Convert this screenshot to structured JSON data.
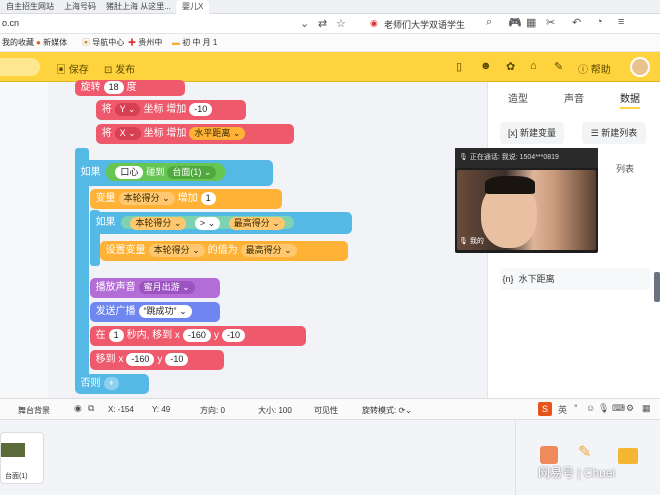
{
  "browser": {
    "tabs": [
      "自主招生网站",
      "上海号码",
      "猪肚上海 从这里...",
      "婴儿X"
    ],
    "address_partial": "o.cn",
    "search_text": "老师们大学双语学生",
    "bookmarks": [
      "我的收藏",
      "新媒体",
      "导航中心",
      "贵州中",
      "初 中 月 1"
    ]
  },
  "editor": {
    "save_label": "保存",
    "publish_label": "发布",
    "tutorial_label": "帮助"
  },
  "right_panel": {
    "tabs": [
      "造型",
      "声音",
      "数据"
    ],
    "new_variable": "新建变量",
    "new_list": "新建列表",
    "list_label": "列表",
    "variable_item": "水下距离",
    "variable_item_icon": "{n}"
  },
  "video_call": {
    "caption": "正在通话: 我说: 1504***0819",
    "mic_label": "我的"
  },
  "blocks": {
    "b1": {
      "prefix": "旋转",
      "value": "18",
      "suffix": "度"
    },
    "b2": {
      "prefix": "将",
      "dd": "Y",
      "mid": "坐标 增加",
      "value": "-10"
    },
    "b3": {
      "prefix": "将",
      "dd": "X",
      "mid": "坐标 增加",
      "value": "水平距离"
    },
    "b4": {
      "prefix": "如果",
      "cond1": "口心",
      "cond_mid": "碰到",
      "cond2": "台面(1)"
    },
    "b5": {
      "prefix": "变量",
      "dd": "本轮得分",
      "mid": "增加",
      "value": "1"
    },
    "b6": {
      "prefix": "如果",
      "lhs": "本轮得分",
      "op": ">",
      "rhs": "最高得分"
    },
    "b7": {
      "prefix": "设置变量",
      "dd": "本轮得分",
      "mid": "的值为",
      "value": "最高得分"
    },
    "b8": {
      "prefix": "播放声音",
      "dd": "蜜月出游"
    },
    "b9": {
      "prefix": "发送广播",
      "dd": "“跳成功”"
    },
    "b10": {
      "prefix": "在",
      "v1": "1",
      "mid1": "秒内, 移到 x",
      "v2": "-160",
      "mid2": "y",
      "v3": "-10"
    },
    "b11": {
      "prefix": "移到 x",
      "v1": "-160",
      "mid": "y",
      "v2": "-10"
    },
    "b12": {
      "prefix": "否则"
    }
  },
  "status": {
    "sprite_label": "舞台背景",
    "x_label": "X:",
    "x_value": "-154",
    "y_label": "Y:",
    "y_value": "49",
    "dir_label": "方向:",
    "dir_value": "0",
    "size_label": "大小:",
    "size_value": "100",
    "visible_label": "可见性",
    "rotation_label": "旋转模式:"
  },
  "bottom": {
    "sprite_thumb_label": "台面(1)",
    "watermark": "网易号 | Chuei"
  },
  "colors": {
    "header": "#ffd33d",
    "motion": "#ee5a6b",
    "control": "#55b9e6",
    "data": "#ffb236",
    "sound": "#b46cd6",
    "events": "#6f86f0",
    "sensing": "#67c653"
  }
}
